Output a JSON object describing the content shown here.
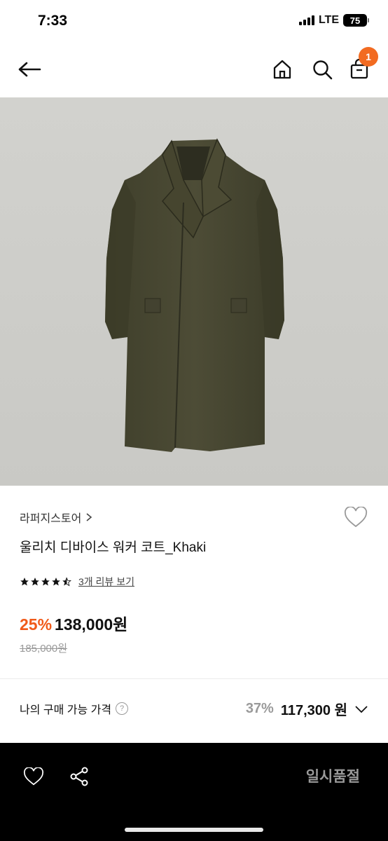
{
  "status": {
    "time": "7:33",
    "network": "LTE",
    "battery": "75"
  },
  "nav": {
    "cart_count": "1",
    "icons": [
      "back-arrow-icon",
      "home-icon",
      "search-icon",
      "shopping-bag-icon"
    ]
  },
  "product": {
    "store": "라퍼지스토어",
    "title": "울리치 디바이스 워커 코트_Khaki",
    "rating": 4.5,
    "review_link": "3개 리뷰 보기",
    "discount": "25%",
    "price": "138,000원",
    "original_price": "185,000원"
  },
  "my_price": {
    "label": "나의 구매 가능 가격",
    "help": "?",
    "discount": "37%",
    "price": "117,300 원"
  },
  "bottom": {
    "status_button": "일시품절"
  },
  "colors": {
    "accent": "#f26b21",
    "discount": "#f05a1a",
    "bottom_bar": "#000000",
    "image_bg": "#cfcfcb",
    "coat": "#4a4a33"
  }
}
